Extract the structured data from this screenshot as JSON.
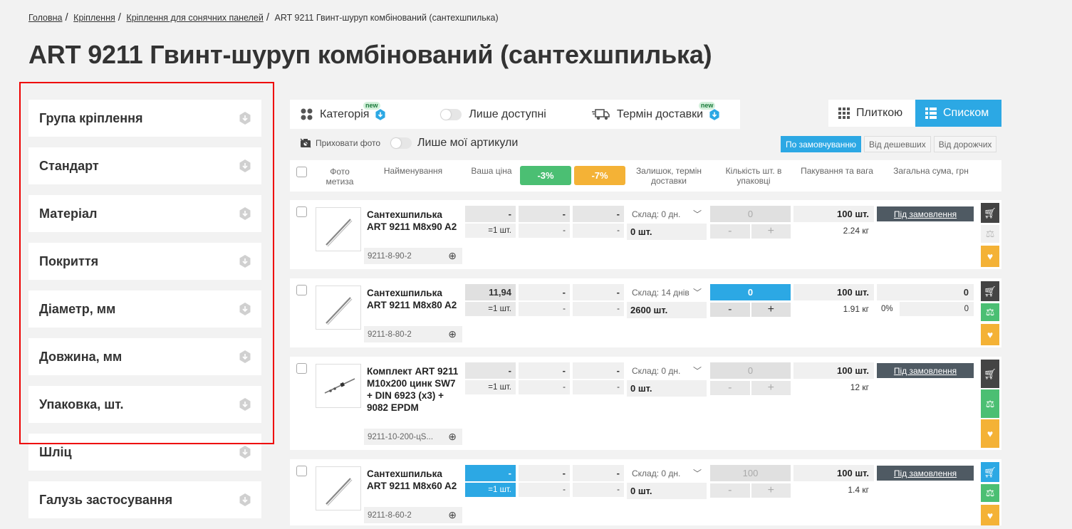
{
  "breadcrumbs": [
    "Головна",
    "Кріплення",
    "Кріплення для сонячних панелей"
  ],
  "breadcrumb_current": "ART 9211 Гвинт-шуруп комбінований (сантехшпилька)",
  "page_title": "ART 9211 Гвинт-шуруп комбінований (сантехшпилька)",
  "filters": [
    "Група кріплення",
    "Стандарт",
    "Матеріал",
    "Покриття",
    "Діаметр, мм",
    "Довжина, мм",
    "Упаковка, шт.",
    "Шліц",
    "Галузь застосування"
  ],
  "toolbar": {
    "category": "Категорія",
    "only_available": "Лише доступні",
    "delivery_term": "Термін доставки",
    "new_badge": "new",
    "view_tile": "Плиткою",
    "view_list": "Списком",
    "hide_photo": "Приховати фото",
    "only_my_articles": "Лише мої артикули"
  },
  "sort": [
    "По замовчуванню",
    "Від дешевших",
    "Від дорожчих"
  ],
  "table_header": {
    "photo": "Фото метиза",
    "name": "Найменування",
    "your_price": "Ваша ціна",
    "disc1": "-3%",
    "disc2": "-7%",
    "stock": "Залишок, термін доставки",
    "qty_in_pack": "Кількість шт. в упаковці",
    "pack_weight": "Пакування та вага",
    "total": "Загальна сума, грн"
  },
  "products": [
    {
      "name": "Сантехшпилька ART 9211 M8x90 A2",
      "sku": "9211-8-90-2",
      "price": "-",
      "price_unit": "=1 шт.",
      "p3": "-",
      "p3s": "-",
      "p7": "-",
      "p7s": "-",
      "stock": "Склад: 0 дн.",
      "stock_qty": "0 шт.",
      "qty": "0",
      "pack": "100 шт.",
      "weight": "2.24 кг",
      "order": "Під замовлення"
    },
    {
      "name": "Сантехшпилька ART 9211 M8x80 A2",
      "sku": "9211-8-80-2",
      "price": "11,94",
      "price_unit": "=1 шт.",
      "p3": "-",
      "p3s": "-",
      "p7": "-",
      "p7s": "-",
      "stock": "Склад: 14 днів",
      "stock_qty": "2600 шт.",
      "qty": "0",
      "pack": "100 шт.",
      "weight": "1.91 кг",
      "sum": "0",
      "sum_pct": "0%",
      "sum_sub": "0"
    },
    {
      "name": "Комплект ART 9211 M10x200 цинк SW7 + DIN 6923 (x3) + 9082 EPDM",
      "sku": "9211-10-200-цS...",
      "price": "-",
      "price_unit": "=1 шт.",
      "p3": "-",
      "p3s": "-",
      "p7": "-",
      "p7s": "-",
      "stock": "Склад: 0 дн.",
      "stock_qty": "0 шт.",
      "qty": "0",
      "pack": "100 шт.",
      "weight": "12 кг",
      "order": "Під замовлення"
    },
    {
      "name": "Сантехшпилька ART 9211 M8x60 A2",
      "sku": "9211-8-60-2",
      "price": "-",
      "price_unit": "=1 шт.",
      "p3": "-",
      "p3s": "-",
      "p7": "-",
      "p7s": "-",
      "stock": "Склад: 0 дн.",
      "stock_qty": "0 шт.",
      "qty": "100",
      "pack": "100 шт.",
      "weight": "1.4 кг",
      "order": "Під замовлення"
    }
  ],
  "stepper": {
    "minus": "-",
    "plus": "+"
  },
  "colors": {
    "accent": "#2ca8e4",
    "green": "#4bbf73",
    "yellow": "#f4b236",
    "dark": "#444444",
    "highlight_box": "#e00000"
  }
}
